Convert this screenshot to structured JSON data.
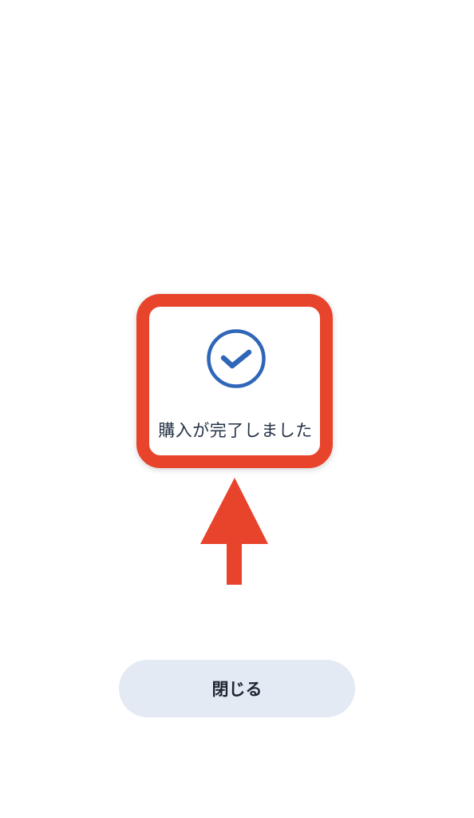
{
  "dialog": {
    "message": "購入が完了しました",
    "icon": "check-circle-icon"
  },
  "annotation": {
    "icon": "arrow-up-icon",
    "color": "#e8432b"
  },
  "actions": {
    "close_label": "閉じる"
  },
  "colors": {
    "accent": "#2f66b8",
    "highlight": "#e8432b",
    "button_bg": "#e3eaf3",
    "text": "#253246"
  }
}
